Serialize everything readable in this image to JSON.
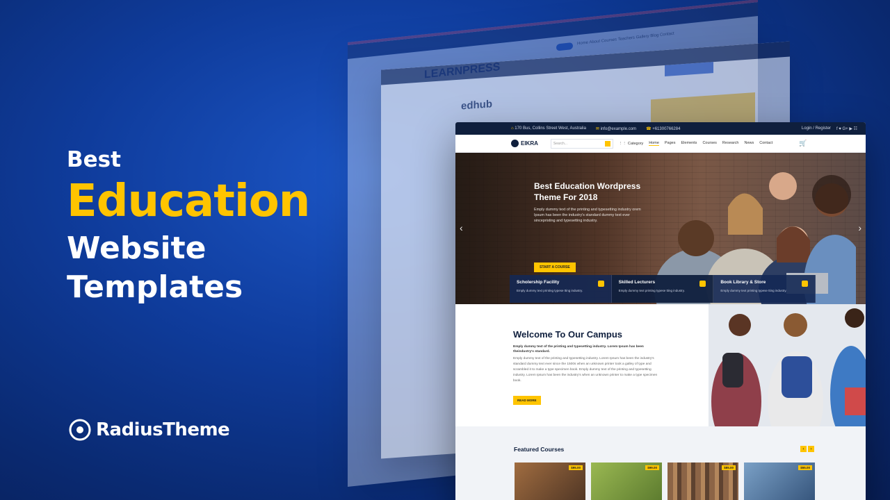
{
  "headline": {
    "best": "Best",
    "main": "Education",
    "line3": "Website",
    "line4": "Templates"
  },
  "brand": {
    "name": "RadiusTheme"
  },
  "back_mockups": {
    "learnpress_logo": "LEARNPRESS",
    "learnpress_nav": "Home   About   Courses   Teachers   Gallery   Blog   Contact",
    "edhub_logo": "edhub"
  },
  "eikra": {
    "topbar": {
      "address": "170 Bus, Collins Street West, Australia",
      "email": "info@example.com",
      "phone": "+61300766284",
      "login": "Login / Register",
      "social": "f  ♥  G+  ▶  ☷"
    },
    "nav": {
      "logo": "EIKRA",
      "search_placeholder": "Search...",
      "category": "Category",
      "menu": [
        "Home",
        "Pages",
        "Elements",
        "Courses",
        "Research",
        "News",
        "Contact"
      ]
    },
    "hero": {
      "title": "Best Education Wordpress Theme For 2018",
      "desc": "Emply dummy text of the printing and typesetting industry orem Ipsum has been the industry's standard dummy text ever sincepristing and typesetting industry.",
      "button": "START A COURSE",
      "features": [
        {
          "title": "Scholership Facility",
          "desc": "Emply dummy text printing typese tting industry."
        },
        {
          "title": "Skilled Lecturers",
          "desc": "Emply dummy text printing typese tting industry."
        },
        {
          "title": "Book Library & Store",
          "desc": "Emply dummy text printing typese tting industry."
        }
      ]
    },
    "welcome": {
      "title": "Welcome To Our Campus",
      "lead": "Emply dummy text of the printing and typesetting industry. Lorem Ipsum has been theindustry's standard.",
      "body": "Emply dummy text of the printing and typesetting industry. Lorem Ipsum has been the industry's standard dummy text ever since the 1500s when an unknown printer took a galley of type and scrambled it to make a type specimen book. Emply dummy text of the printing and typesetting industry. Lorem Ipsum has been the industry's when an unknown printer to make a type specimen book.",
      "button": "READ MORE"
    },
    "featured": {
      "title": "Featured Courses",
      "prev": "‹",
      "next": "›",
      "cards": [
        {
          "price": "$95.00",
          "bg": "#6a4f3a"
        },
        {
          "price": "$99.00",
          "bg": "#6f8f3c"
        },
        {
          "price": "$85.00",
          "bg": "#8a6a4c"
        },
        {
          "price": "$55.00",
          "bg": "#4a6d93"
        }
      ]
    }
  },
  "colors": {
    "accent": "#ffc400",
    "navy": "#0f1f3d",
    "background": "#0f3c9c"
  }
}
